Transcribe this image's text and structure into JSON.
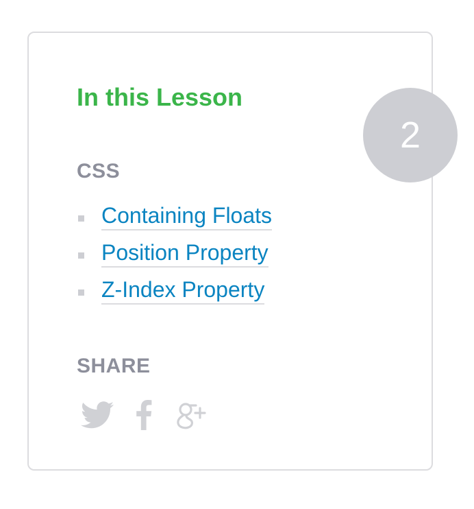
{
  "colors": {
    "title": "#3bb54a",
    "label": "#8d8f9b",
    "link": "#0a84c1",
    "badge_bg": "#cdced3",
    "icon": "#d0d1d5"
  },
  "lesson": {
    "title": "In this Lesson",
    "number": "2"
  },
  "topics": {
    "heading": "CSS",
    "items": [
      {
        "label": "Containing Floats"
      },
      {
        "label": "Position Property"
      },
      {
        "label": "Z-Index Property"
      }
    ]
  },
  "share": {
    "heading": "SHARE",
    "icons": [
      "twitter-icon",
      "facebook-icon",
      "google-plus-icon"
    ]
  }
}
